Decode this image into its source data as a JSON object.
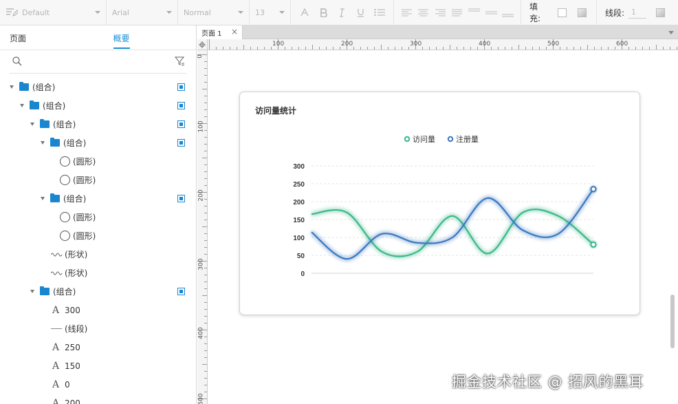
{
  "toolbar": {
    "font_style": "Default",
    "font_family": "Arial",
    "font_weight": "Normal",
    "font_size": "13",
    "fill_label": "填充:",
    "stroke_label": "线段:",
    "stroke_value": "1"
  },
  "left_panel": {
    "tabs": [
      {
        "label": "页面"
      },
      {
        "label": "概要"
      }
    ],
    "tree": [
      {
        "type": "group",
        "label": "(组合)",
        "indent": 0
      },
      {
        "type": "group",
        "label": "(组合)",
        "indent": 1
      },
      {
        "type": "group",
        "label": "(组合)",
        "indent": 2
      },
      {
        "type": "group",
        "label": "(组合)",
        "indent": 3
      },
      {
        "type": "circle",
        "label": "(圆形)",
        "indent": 5
      },
      {
        "type": "circle",
        "label": "(圆形)",
        "indent": 5
      },
      {
        "type": "group",
        "label": "(组合)",
        "indent": 3
      },
      {
        "type": "circle",
        "label": "(圆形)",
        "indent": 5
      },
      {
        "type": "circle",
        "label": "(圆形)",
        "indent": 5
      },
      {
        "type": "shape",
        "label": "(形状)",
        "indent": 4
      },
      {
        "type": "shape",
        "label": "(形状)",
        "indent": 4
      },
      {
        "type": "group",
        "label": "(组合)",
        "indent": 2
      },
      {
        "type": "text",
        "label": "300",
        "indent": 4
      },
      {
        "type": "line",
        "label": "(线段)",
        "indent": 4
      },
      {
        "type": "text",
        "label": "250",
        "indent": 4
      },
      {
        "type": "text",
        "label": "150",
        "indent": 4
      },
      {
        "type": "text",
        "label": "0",
        "indent": 4
      },
      {
        "type": "text",
        "label": "200",
        "indent": 4
      }
    ]
  },
  "page_tab": {
    "label": "页面 1",
    "close": "×"
  },
  "rulers": {
    "h": [
      "100",
      "200",
      "300",
      "400",
      "500",
      "600"
    ],
    "v": [
      "0",
      "100",
      "200",
      "300",
      "400",
      "500"
    ]
  },
  "watermark": "掘金技术社区 @ 招风的黑耳",
  "chart_data": {
    "type": "line",
    "title": "访问量统计",
    "legend_position": "top-center",
    "y_ticks": [
      "300",
      "250",
      "200",
      "150",
      "100",
      "50",
      "0"
    ],
    "ylim": [
      0,
      300
    ],
    "x": [
      0,
      1,
      2,
      3,
      4,
      5,
      6,
      7,
      8
    ],
    "series": [
      {
        "name": "访问量",
        "color": "#3cb88a",
        "smooth": true,
        "values": [
          165,
          170,
          60,
          60,
          160,
          55,
          170,
          160,
          80
        ]
      },
      {
        "name": "注册量",
        "color": "#3a79c0",
        "smooth": true,
        "values": [
          115,
          40,
          110,
          85,
          100,
          210,
          120,
          110,
          235
        ]
      }
    ]
  }
}
